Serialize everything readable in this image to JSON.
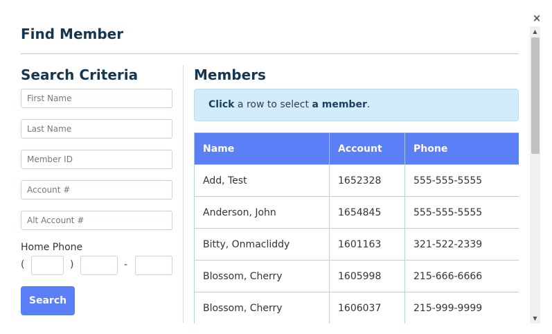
{
  "modal": {
    "title": "Find Member",
    "close_glyph": "×"
  },
  "search": {
    "heading": "Search Criteria",
    "first_name_placeholder": "First Name",
    "last_name_placeholder": "Last Name",
    "member_id_placeholder": "Member ID",
    "account_placeholder": "Account #",
    "alt_account_placeholder": "Alt Account #",
    "home_phone_label": "Home Phone",
    "paren_open": "(",
    "paren_close": ")",
    "dash": "-",
    "button_label": "Search"
  },
  "members": {
    "heading": "Members",
    "hint": {
      "part1": "Click",
      "part2": " a row to select ",
      "part3": "a member",
      "part4": "."
    },
    "columns": [
      "Name",
      "Account",
      "Phone"
    ],
    "rows": [
      {
        "name": "Add, Test",
        "account": "1652328",
        "phone": "555-555-5555"
      },
      {
        "name": "Anderson, John",
        "account": "1654845",
        "phone": "555-555-5555"
      },
      {
        "name": "Bitty, Onmacliddy",
        "account": "1601163",
        "phone": "321-522-2339"
      },
      {
        "name": "Blossom, Cherry",
        "account": "1605998",
        "phone": "215-666-6666"
      },
      {
        "name": "Blossom, Cherry",
        "account": "1606037",
        "phone": "215-999-9999"
      }
    ]
  },
  "colors": {
    "accent": "#5b7ff6",
    "heading": "#16364f",
    "hint_bg": "#d3ecfb"
  },
  "icons": {
    "close": "close-icon",
    "scroll_up": "chevron-up-icon",
    "scroll_down": "chevron-down-icon"
  }
}
